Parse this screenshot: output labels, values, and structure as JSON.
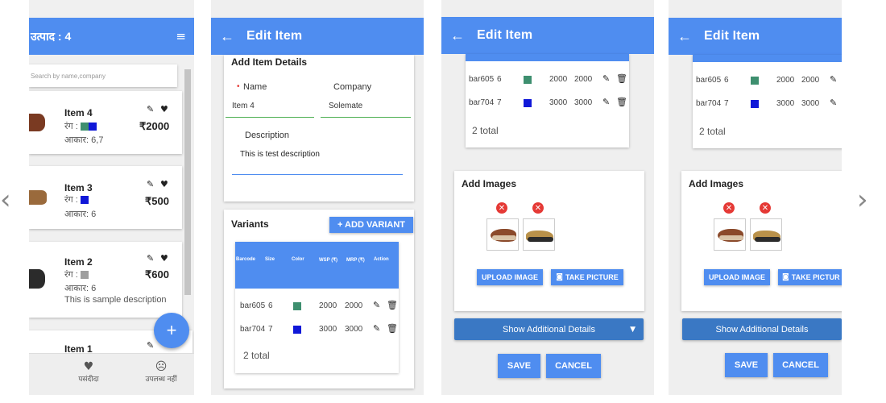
{
  "screen1": {
    "title": "उत्पाद : 4",
    "search_placeholder": "Search by name,company",
    "items": [
      {
        "name": "Item 4",
        "color_label": "रंग :",
        "size_label": "आकार: 6,7",
        "price": "₹2000",
        "desc": ""
      },
      {
        "name": "Item 3",
        "color_label": "रंग :",
        "size_label": "आकार: 6",
        "price": "₹500",
        "desc": ""
      },
      {
        "name": "Item 2",
        "color_label": "रंग :",
        "size_label": "आकार: 6",
        "price": "₹600",
        "desc": "This is sample description"
      },
      {
        "name": "Item 1",
        "color_label": "",
        "size_label": "",
        "price": "",
        "desc": ""
      }
    ],
    "fab": "+",
    "bottom_nav": [
      {
        "label": "पसंदीदा"
      },
      {
        "label": "उपलब्ध नहीं"
      }
    ]
  },
  "screen2": {
    "title": "Edit Item",
    "section_title": "Add Item Details",
    "name_label": "Name",
    "name_value": "Item 4",
    "company_label": "Company",
    "company_value": "Solemate",
    "desc_label": "Description",
    "desc_value": "This is test description",
    "variants_title": "Variants",
    "add_variant": "+ ADD VARIANT",
    "table_headers": [
      "Barcode",
      "Size",
      "Color",
      "WSP (₹)",
      "MRP (₹)",
      "Action"
    ],
    "rows": [
      {
        "barcode": "bar605",
        "size": "6",
        "color": "#3e8f6f",
        "wsp": "2000",
        "mrp": "2000"
      },
      {
        "barcode": "bar704",
        "size": "7",
        "color": "#1018d8",
        "wsp": "3000",
        "mrp": "3000"
      }
    ],
    "total": "2 total"
  },
  "screen3": {
    "title": "Edit Item",
    "rows": [
      {
        "barcode": "bar605",
        "size": "6",
        "color": "#3e8f6f",
        "wsp": "2000",
        "mrp": "2000"
      },
      {
        "barcode": "bar704",
        "size": "7",
        "color": "#1018d8",
        "wsp": "3000",
        "mrp": "3000"
      }
    ],
    "total": "2 total",
    "add_images": "Add Images",
    "upload": "UPLOAD IMAGE",
    "take_picture": "TAKE PICTURE",
    "additional": "Show Additional Details",
    "save": "SAVE",
    "cancel": "CANCEL"
  },
  "screen4": {
    "title": "Edit Item",
    "rows": [
      {
        "barcode": "bar605",
        "size": "6",
        "color": "#3e8f6f",
        "wsp": "2000",
        "mrp": "2000"
      },
      {
        "barcode": "bar704",
        "size": "7",
        "color": "#1018d8",
        "wsp": "3000",
        "mrp": "3000"
      }
    ],
    "total": "2 total",
    "add_images": "Add Images",
    "upload": "UPLOAD IMAGE",
    "take_picture": "TAKE PICTUR",
    "additional": "Show Additional Details",
    "save": "SAVE",
    "cancel": "CANCEL"
  },
  "colors": {
    "accent": "#4f8df0",
    "dark_blue": "#3a78c4"
  },
  "nav": {
    "prev": "‹",
    "next": "›"
  }
}
